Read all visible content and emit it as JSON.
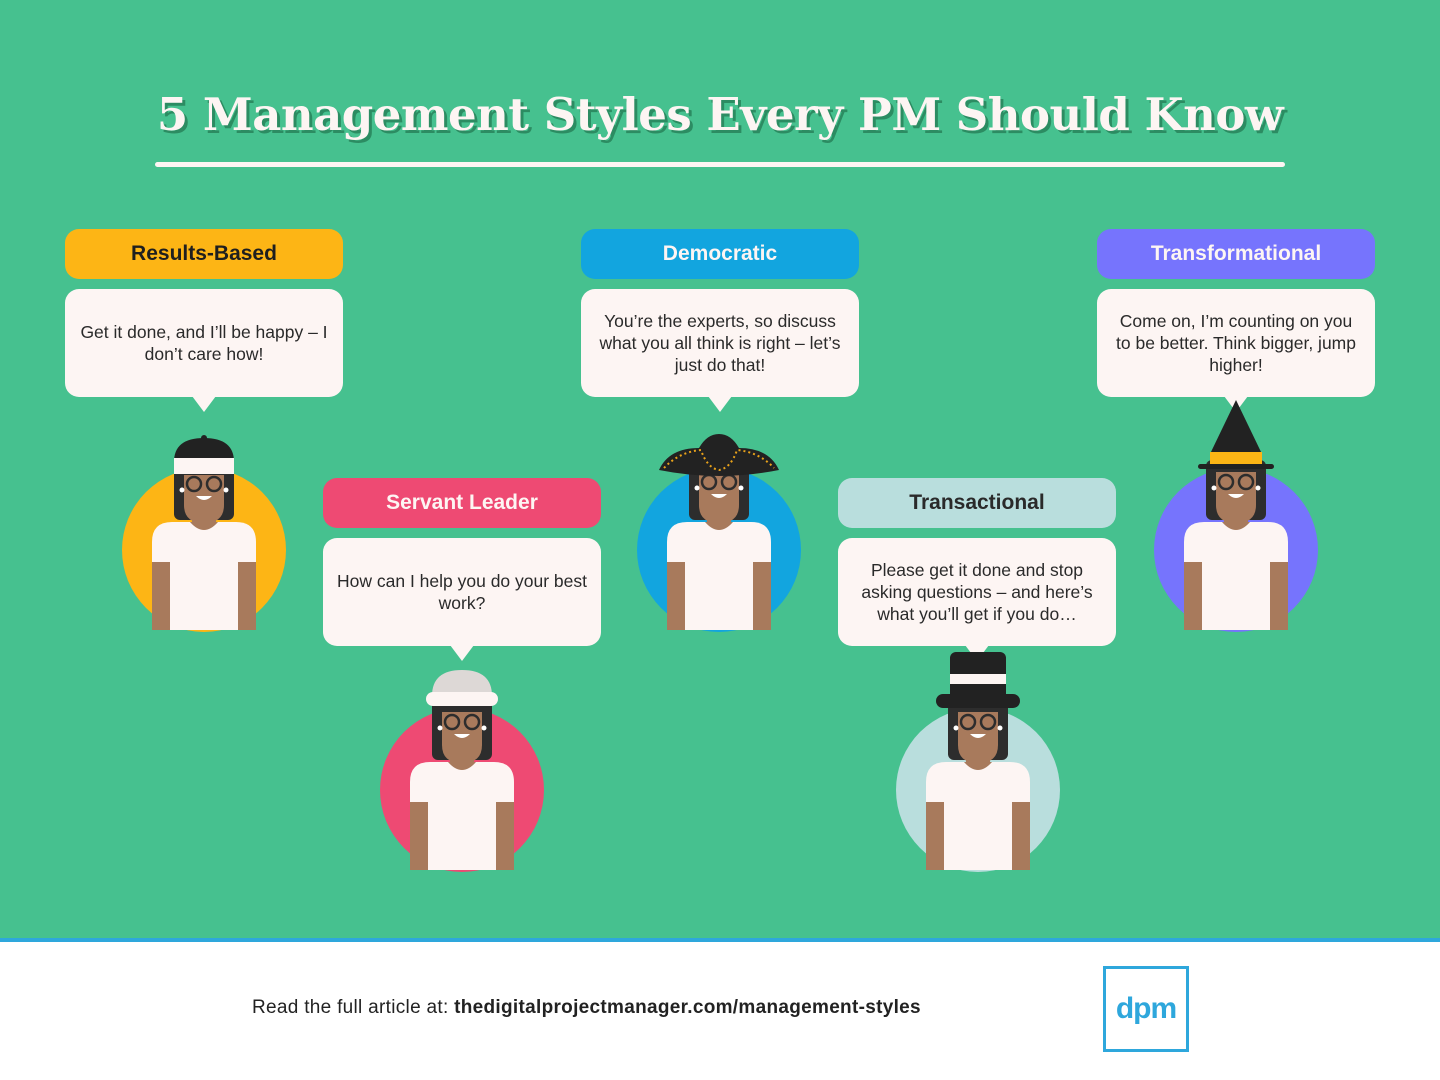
{
  "title": "5 Management Styles Every PM Should Know",
  "colors": {
    "background": "#46c18f",
    "bubble": "#fdf5f3",
    "accent_blue": "#2ea7dc"
  },
  "styles": [
    {
      "name": "Results-Based",
      "quote": "Get it done, and I’ll be happy – I don’t care how!",
      "color": "#fdb515",
      "text_color": "#1f1f1f",
      "hat": "headband-beret-icon"
    },
    {
      "name": "Servant Leader",
      "quote": "How can I help you do your best work?",
      "color": "#ee4a73",
      "text_color": "#fdf5f3",
      "hat": "chef-beanie-icon"
    },
    {
      "name": "Democratic",
      "quote": "You’re the experts, so discuss what you all think is right – let’s just do that!",
      "color": "#12a5df",
      "text_color": "#fdf5f3",
      "hat": "tricorn-hat-icon"
    },
    {
      "name": "Transactional",
      "quote": "Please get it done and stop asking questions – and here’s what you’ll get if you do…",
      "color": "#b9dedd",
      "text_color": "#2a2a2a",
      "hat": "top-hat-icon"
    },
    {
      "name": "Transformational",
      "quote": "Come on, I’m counting on you to be better. Think bigger, jump higher!",
      "color": "#7674fd",
      "text_color": "#fdf5f3",
      "hat": "witch-hat-icon"
    }
  ],
  "footer": {
    "prefix": "Read the full article at: ",
    "url": "thedigitalprojectmanager.com/management-styles",
    "logo": "dpm"
  }
}
